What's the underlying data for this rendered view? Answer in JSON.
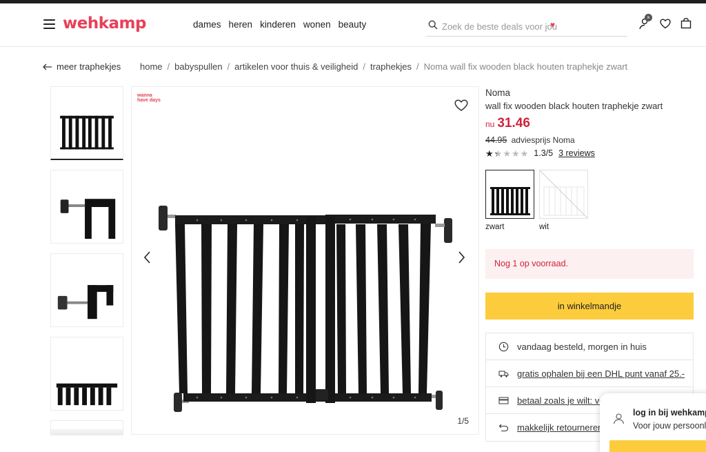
{
  "header": {
    "logo": "wehkamp",
    "nav": [
      "dames",
      "heren",
      "kinderen",
      "wonen",
      "beauty"
    ],
    "search_placeholder": "Zoek de beste deals voor jou",
    "icons": [
      "account-icon",
      "heart-icon",
      "bag-icon"
    ]
  },
  "breadcrumb": {
    "back_label": "meer traphekjes",
    "items": [
      "home",
      "babyspullen",
      "artikelen voor thuis & veiligheid",
      "traphekjes",
      "Noma wall fix wooden black houten traphekje zwart"
    ]
  },
  "gallery": {
    "badge": "wanna have days",
    "counter": "1/5"
  },
  "product": {
    "brand": "Noma",
    "title": "wall fix wooden black houten traphekje zwart",
    "price_prefix": "nu",
    "price": "31.46",
    "old_price": "44.95",
    "old_price_label": "adviesprijs Noma",
    "rating": 1.3,
    "rating_text": "1.3/5",
    "reviews": "3 reviews",
    "swatches": [
      {
        "label": "zwart",
        "selected": true
      },
      {
        "label": "wit",
        "selected": false
      }
    ],
    "stock_message": "Nog 1 op voorraad.",
    "cart_button": "in winkelmandje",
    "benefits": [
      {
        "icon": "clock-icon",
        "text": "vandaag besteld, morgen in huis",
        "link": false
      },
      {
        "icon": "truck-icon",
        "text": "gratis ophalen bij een DHL punt vanaf 25.-",
        "link": true
      },
      {
        "icon": "card-icon",
        "text": "betaal zoals je wilt: vo",
        "link": true
      },
      {
        "icon": "return-icon",
        "text": "makkelijk retourneren",
        "link": true
      }
    ]
  },
  "login_popup": {
    "title": "log in bij wehkamp",
    "subtitle": "Voor jouw persoonli"
  },
  "colors": {
    "brand": "#e8405a",
    "price": "#d1223b",
    "cta": "#fccc3c",
    "stock_bg": "#fdf0f0"
  }
}
